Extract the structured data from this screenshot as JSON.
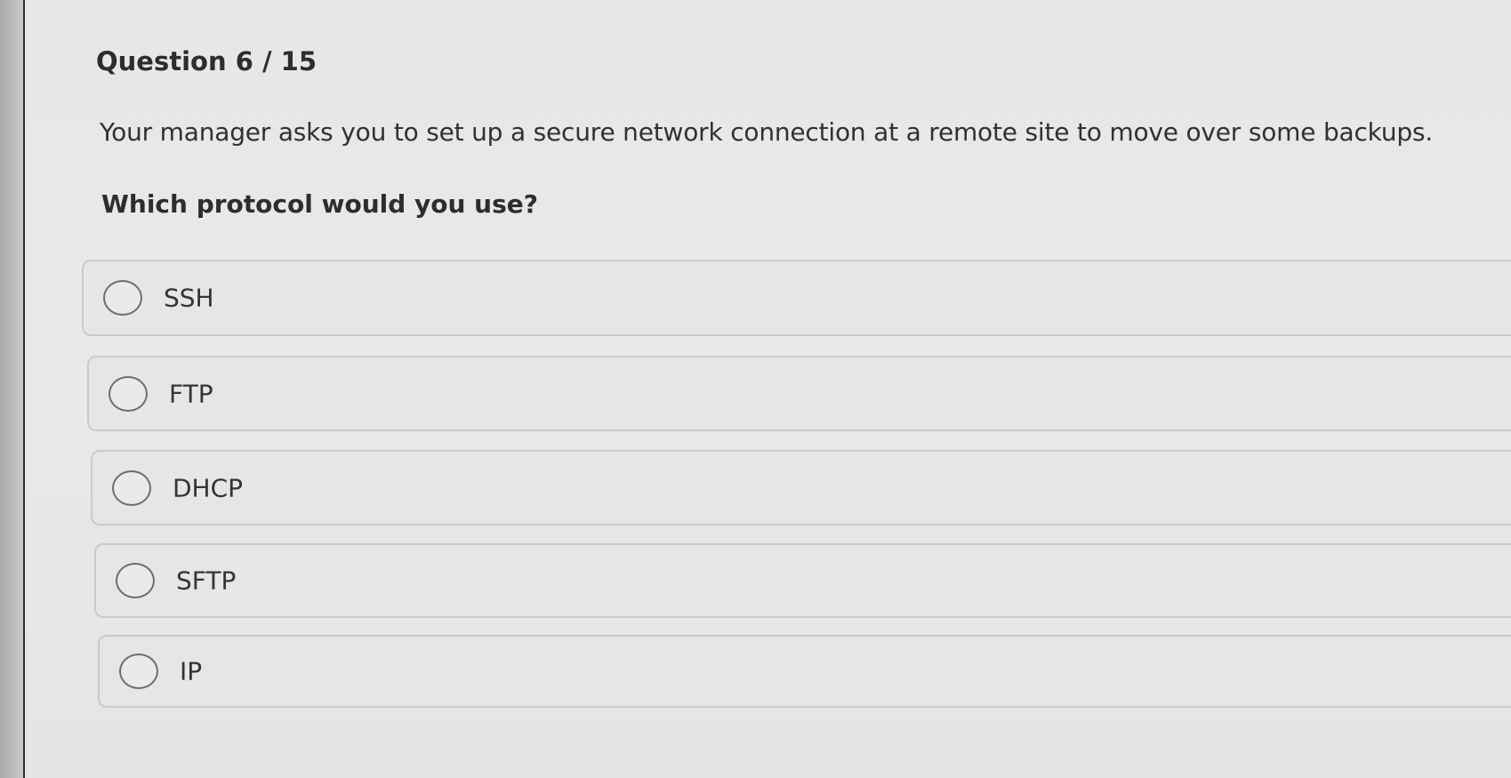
{
  "quiz": {
    "counter": "Question 6 / 15",
    "prompt": "Your manager asks you to set up a secure network connection at a remote site to move over some backups.",
    "question": "Which protocol would you use?",
    "options": [
      {
        "label": "SSH"
      },
      {
        "label": "FTP"
      },
      {
        "label": "DHCP"
      },
      {
        "label": "SFTP"
      },
      {
        "label": "IP"
      }
    ]
  }
}
